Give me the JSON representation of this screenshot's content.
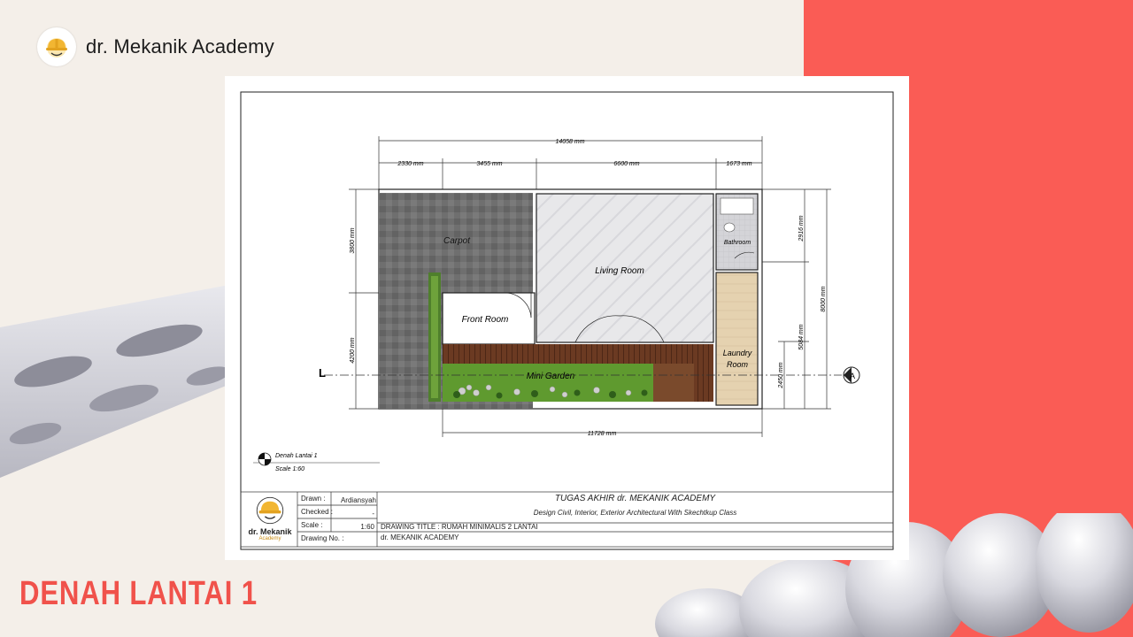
{
  "brand": {
    "name": "dr. Mekanik Academy"
  },
  "page_title": "DENAH LANTAI 1",
  "plan": {
    "dims_top": {
      "total": "14058 mm",
      "seg1": "2330 mm",
      "seg2": "3455 mm",
      "seg3": "6600 mm",
      "seg4": "1673 mm"
    },
    "dims_left": {
      "upper": "3800 mm",
      "lower": "4200 mm"
    },
    "dims_right": {
      "a": "2916 mm",
      "b": "5084 mm",
      "c": "2450 mm",
      "total": "8000 mm"
    },
    "dim_bottom": "11728 mm",
    "rooms": {
      "carport": "Carpot",
      "living": "Living Room",
      "front": "Front Room",
      "garden": "Mini Garden",
      "bathroom": "Bathroom",
      "laundry1": "Laundry",
      "laundry2": "Room"
    },
    "section_left": "L",
    "section_right": "A"
  },
  "drawing_label": {
    "name": "Denah Lantai 1",
    "scale": "Scale 1:60"
  },
  "title_block": {
    "logo_line1": "dr. Mekanik",
    "logo_line2": "Academy",
    "drawn_label": "Drawn",
    "drawn_value": "Ardiansyah",
    "checked_label": "Checked",
    "checked_value": "-",
    "scale_label": "Scale",
    "scale_value": "1:60",
    "drawing_no_label": "Drawing No.",
    "project_title": "TUGAS AKHIR dr. MEKANIK ACADEMY",
    "project_subtitle": "Design Civil, Interior, Exterior Architectural With Skechtkup Class",
    "drawing_title": "DRAWING TITLE : RUMAH MINIMALIS 2 LANTAI",
    "drawing_no_value": "dr. MEKANIK ACADEMY"
  },
  "colors": {
    "accent": "#fa5c55",
    "title": "#f0524b",
    "background": "#f4efe9"
  }
}
